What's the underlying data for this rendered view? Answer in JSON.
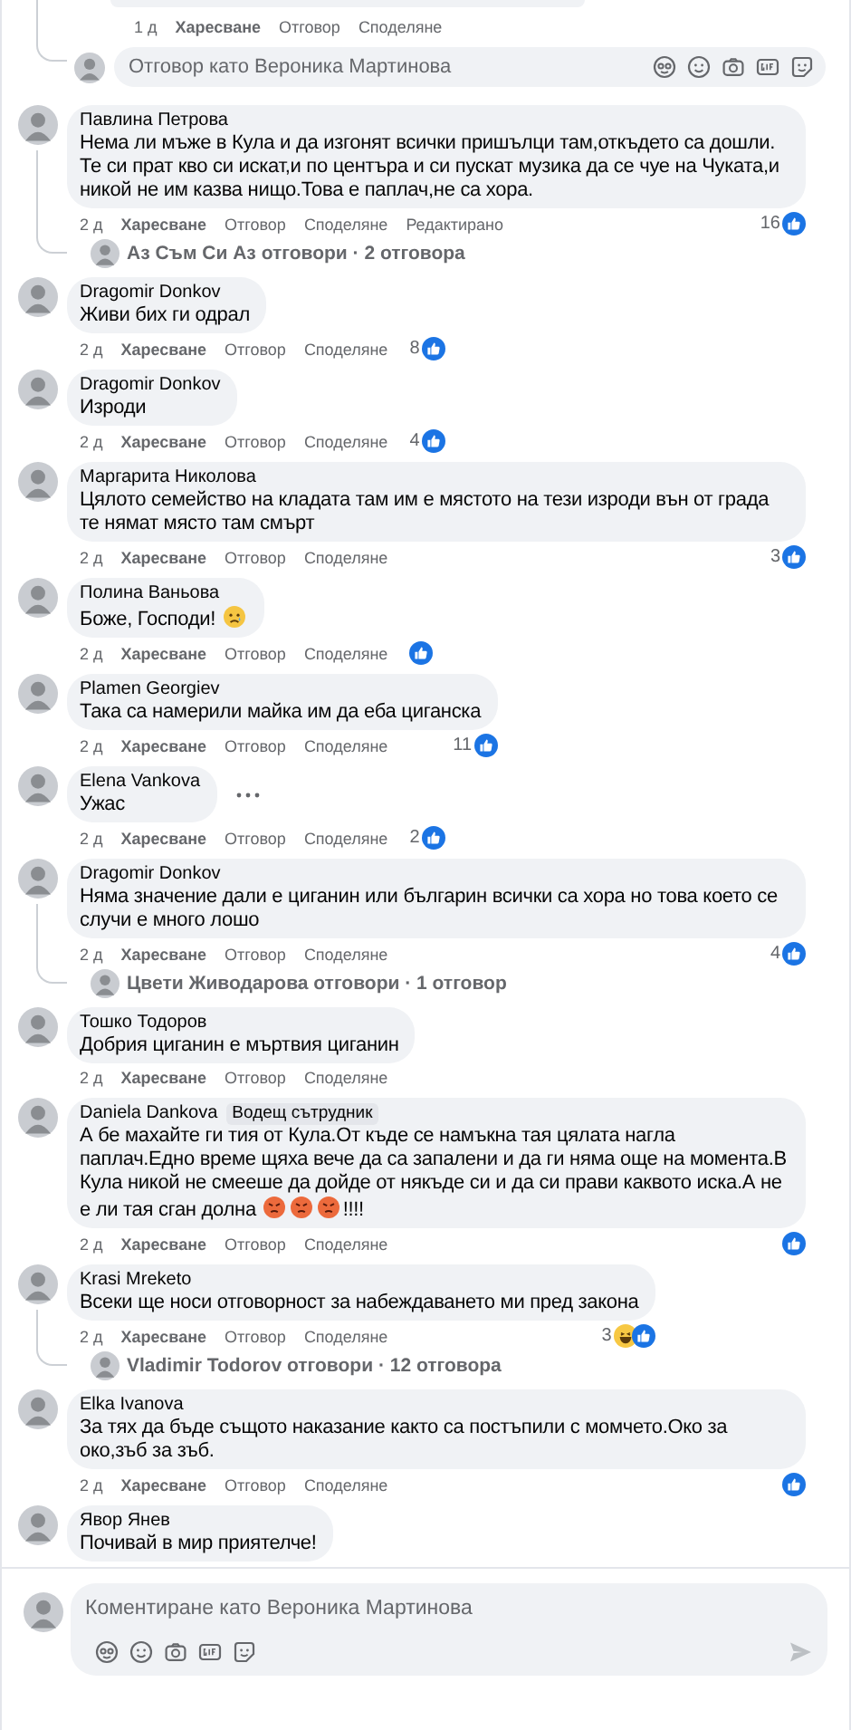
{
  "previous_reply": {
    "time": "1 д",
    "actions": [
      "Харесване",
      "Отговор",
      "Споделяне"
    ]
  },
  "reply_field": {
    "placeholder": "Отговор като Вероника Мартинова"
  },
  "comments": [
    {
      "author": "Павлина Петрова",
      "text": "Нема ли мъже в Кула и да изгонят всички пришълци там,откъдето са дошли. Те си прат кво си искат,и по центъра и си пускат музика да се чуе на Чуката,и никой не им казва нищо.Това е паплач,не са хора.",
      "time": "2 д",
      "actions": [
        "Харесване",
        "Отговор",
        "Споделяне"
      ],
      "edited": "Редактирано",
      "reaction_count": "16",
      "reactions": [
        {
          "kind": "like"
        }
      ],
      "replies": "Аз Съм Си Аз отговори · 2 отговора"
    },
    {
      "author": "Dragomir Donkov",
      "text": "Живи бих ги одрал",
      "time": "2 д",
      "actions": [
        "Харесване",
        "Отговор",
        "Споделяне"
      ],
      "reaction_count": "8",
      "reactions": [
        {
          "kind": "like"
        }
      ]
    },
    {
      "author": "Dragomir Donkov",
      "text": "Изроди",
      "time": "2 д",
      "actions": [
        "Харесване",
        "Отговор",
        "Споделяне"
      ],
      "reaction_count": "4",
      "reactions": [
        {
          "kind": "like"
        }
      ]
    },
    {
      "author": "Маргарита Николова",
      "text": "Цялото семейство на кладата там им е мястото на тези изроди вън от града те нямат място там смърт",
      "time": "2 д",
      "actions": [
        "Харесване",
        "Отговор",
        "Споделяне"
      ],
      "reaction_count": "3",
      "reactions": [
        {
          "kind": "like"
        }
      ]
    },
    {
      "author": "Полина Ваньова",
      "text": "Боже, Господи! ",
      "emoji": [
        {
          "kind": "sad"
        }
      ],
      "time": "2 д",
      "actions": [
        "Харесване",
        "Отговор",
        "Споделяне"
      ],
      "reactions": [
        {
          "kind": "like"
        }
      ]
    },
    {
      "author": "Plamen Georgiev",
      "text": "Така са намерили майка им да еба циганска",
      "time": "2 д",
      "actions": [
        "Харесване",
        "Отговор",
        "Споделяне"
      ],
      "reaction_count": "11",
      "reactions": [
        {
          "kind": "like"
        }
      ]
    },
    {
      "author": "Elena Vankova",
      "text": "Ужас",
      "show_menu": true,
      "time": "2 д",
      "actions": [
        "Харесване",
        "Отговор",
        "Споделяне"
      ],
      "reaction_count": "2",
      "reactions": [
        {
          "kind": "like"
        }
      ]
    },
    {
      "author": "Dragomir Donkov",
      "text": "Няма значение дали е циганин или българин всички са хора но това което се случи е много лошо",
      "time": "2 д",
      "actions": [
        "Харесване",
        "Отговор",
        "Споделяне"
      ],
      "reaction_count": "4",
      "reactions": [
        {
          "kind": "like"
        }
      ],
      "replies": "Цвети Живодарова отговори · 1 отговор"
    },
    {
      "author": "Тошко Тодоров",
      "text": "Добрия циганин е мъртвия циганин",
      "time": "2 д",
      "actions": [
        "Харесване",
        "Отговор",
        "Споделяне"
      ]
    },
    {
      "author": "Daniela Dankova",
      "badge": "Водещ сътрудник",
      "text": "А бе махайте ги тия от Кула.От къде се намъкна тая цялата нагла паплач.Едно време щяха вече да са запалени и да ги няма още на момента.В Кула никой не смееше да дойде от някъде си и да си прави каквото иска.А не е ли тая сган долна ",
      "emoji": [
        {
          "kind": "angry"
        },
        {
          "kind": "angry"
        },
        {
          "kind": "angry"
        }
      ],
      "text_after": "!!!!",
      "time": "2 д",
      "actions": [
        "Харесване",
        "Отговор",
        "Споделяне"
      ],
      "reactions": [
        {
          "kind": "like"
        }
      ]
    },
    {
      "author": "Krasi Mreketo",
      "text": "Всеки ще носи отговорност за набеждаването ми пред закона",
      "time": "2 д",
      "actions": [
        "Харесване",
        "Отговор",
        "Споделяне"
      ],
      "reaction_count": "3",
      "reactions": [
        {
          "kind": "haha"
        },
        {
          "kind": "like"
        }
      ],
      "replies": "Vladimir Todorov отговори · 12 отговора"
    },
    {
      "author": "Elka Ivanova",
      "text": "За тях да бъде същото наказание както са постъпили с момчето.Око за око,зъб за зъб.",
      "time": "2 д",
      "actions": [
        "Харесване",
        "Отговор",
        "Споделяне"
      ],
      "reactions": [
        {
          "kind": "like"
        }
      ]
    },
    {
      "author": "Явор Янев",
      "text": "Почивай в мир приятелче!"
    }
  ],
  "composer": {
    "placeholder": "Коментиране като Вероника Мартинова"
  }
}
